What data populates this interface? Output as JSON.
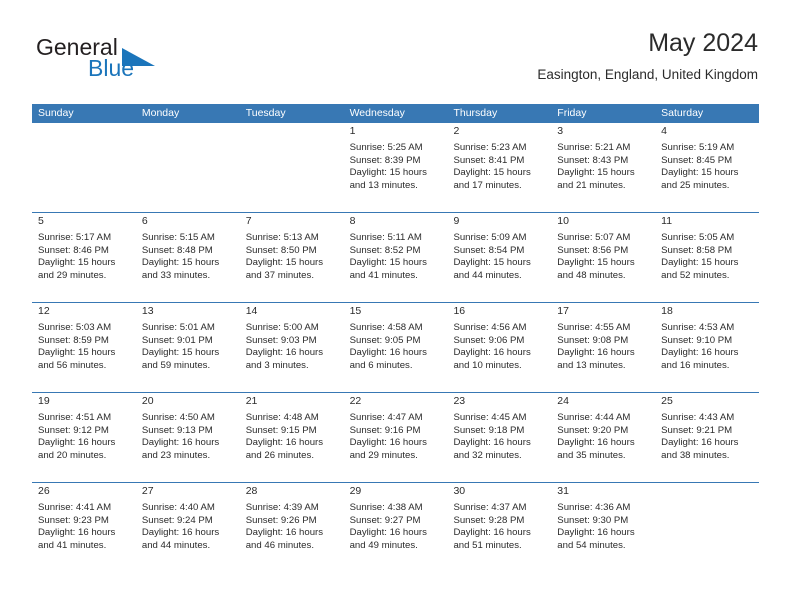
{
  "brand": {
    "name_primary": "General",
    "name_secondary": "Blue",
    "triangle_icon": "triangle-icon",
    "primary_color": "#231f20",
    "accent_color": "#1b75bb"
  },
  "header": {
    "title": "May 2024",
    "subtitle": "Easington, England, United Kingdom"
  },
  "theme": {
    "header_blue": "#3878b4",
    "daynum_band": "#f0f0f0",
    "text": "#2b2b2b",
    "page_background": "#ffffff"
  },
  "calendar": {
    "weekdays": [
      "Sunday",
      "Monday",
      "Tuesday",
      "Wednesday",
      "Thursday",
      "Friday",
      "Saturday"
    ],
    "weeks": [
      [
        {
          "day": "",
          "lines": []
        },
        {
          "day": "",
          "lines": []
        },
        {
          "day": "",
          "lines": []
        },
        {
          "day": "1",
          "lines": [
            "Sunrise: 5:25 AM",
            "Sunset: 8:39 PM",
            "Daylight: 15 hours",
            "and 13 minutes."
          ]
        },
        {
          "day": "2",
          "lines": [
            "Sunrise: 5:23 AM",
            "Sunset: 8:41 PM",
            "Daylight: 15 hours",
            "and 17 minutes."
          ]
        },
        {
          "day": "3",
          "lines": [
            "Sunrise: 5:21 AM",
            "Sunset: 8:43 PM",
            "Daylight: 15 hours",
            "and 21 minutes."
          ]
        },
        {
          "day": "4",
          "lines": [
            "Sunrise: 5:19 AM",
            "Sunset: 8:45 PM",
            "Daylight: 15 hours",
            "and 25 minutes."
          ]
        }
      ],
      [
        {
          "day": "5",
          "lines": [
            "Sunrise: 5:17 AM",
            "Sunset: 8:46 PM",
            "Daylight: 15 hours",
            "and 29 minutes."
          ]
        },
        {
          "day": "6",
          "lines": [
            "Sunrise: 5:15 AM",
            "Sunset: 8:48 PM",
            "Daylight: 15 hours",
            "and 33 minutes."
          ]
        },
        {
          "day": "7",
          "lines": [
            "Sunrise: 5:13 AM",
            "Sunset: 8:50 PM",
            "Daylight: 15 hours",
            "and 37 minutes."
          ]
        },
        {
          "day": "8",
          "lines": [
            "Sunrise: 5:11 AM",
            "Sunset: 8:52 PM",
            "Daylight: 15 hours",
            "and 41 minutes."
          ]
        },
        {
          "day": "9",
          "lines": [
            "Sunrise: 5:09 AM",
            "Sunset: 8:54 PM",
            "Daylight: 15 hours",
            "and 44 minutes."
          ]
        },
        {
          "day": "10",
          "lines": [
            "Sunrise: 5:07 AM",
            "Sunset: 8:56 PM",
            "Daylight: 15 hours",
            "and 48 minutes."
          ]
        },
        {
          "day": "11",
          "lines": [
            "Sunrise: 5:05 AM",
            "Sunset: 8:58 PM",
            "Daylight: 15 hours",
            "and 52 minutes."
          ]
        }
      ],
      [
        {
          "day": "12",
          "lines": [
            "Sunrise: 5:03 AM",
            "Sunset: 8:59 PM",
            "Daylight: 15 hours",
            "and 56 minutes."
          ]
        },
        {
          "day": "13",
          "lines": [
            "Sunrise: 5:01 AM",
            "Sunset: 9:01 PM",
            "Daylight: 15 hours",
            "and 59 minutes."
          ]
        },
        {
          "day": "14",
          "lines": [
            "Sunrise: 5:00 AM",
            "Sunset: 9:03 PM",
            "Daylight: 16 hours",
            "and 3 minutes."
          ]
        },
        {
          "day": "15",
          "lines": [
            "Sunrise: 4:58 AM",
            "Sunset: 9:05 PM",
            "Daylight: 16 hours",
            "and 6 minutes."
          ]
        },
        {
          "day": "16",
          "lines": [
            "Sunrise: 4:56 AM",
            "Sunset: 9:06 PM",
            "Daylight: 16 hours",
            "and 10 minutes."
          ]
        },
        {
          "day": "17",
          "lines": [
            "Sunrise: 4:55 AM",
            "Sunset: 9:08 PM",
            "Daylight: 16 hours",
            "and 13 minutes."
          ]
        },
        {
          "day": "18",
          "lines": [
            "Sunrise: 4:53 AM",
            "Sunset: 9:10 PM",
            "Daylight: 16 hours",
            "and 16 minutes."
          ]
        }
      ],
      [
        {
          "day": "19",
          "lines": [
            "Sunrise: 4:51 AM",
            "Sunset: 9:12 PM",
            "Daylight: 16 hours",
            "and 20 minutes."
          ]
        },
        {
          "day": "20",
          "lines": [
            "Sunrise: 4:50 AM",
            "Sunset: 9:13 PM",
            "Daylight: 16 hours",
            "and 23 minutes."
          ]
        },
        {
          "day": "21",
          "lines": [
            "Sunrise: 4:48 AM",
            "Sunset: 9:15 PM",
            "Daylight: 16 hours",
            "and 26 minutes."
          ]
        },
        {
          "day": "22",
          "lines": [
            "Sunrise: 4:47 AM",
            "Sunset: 9:16 PM",
            "Daylight: 16 hours",
            "and 29 minutes."
          ]
        },
        {
          "day": "23",
          "lines": [
            "Sunrise: 4:45 AM",
            "Sunset: 9:18 PM",
            "Daylight: 16 hours",
            "and 32 minutes."
          ]
        },
        {
          "day": "24",
          "lines": [
            "Sunrise: 4:44 AM",
            "Sunset: 9:20 PM",
            "Daylight: 16 hours",
            "and 35 minutes."
          ]
        },
        {
          "day": "25",
          "lines": [
            "Sunrise: 4:43 AM",
            "Sunset: 9:21 PM",
            "Daylight: 16 hours",
            "and 38 minutes."
          ]
        }
      ],
      [
        {
          "day": "26",
          "lines": [
            "Sunrise: 4:41 AM",
            "Sunset: 9:23 PM",
            "Daylight: 16 hours",
            "and 41 minutes."
          ]
        },
        {
          "day": "27",
          "lines": [
            "Sunrise: 4:40 AM",
            "Sunset: 9:24 PM",
            "Daylight: 16 hours",
            "and 44 minutes."
          ]
        },
        {
          "day": "28",
          "lines": [
            "Sunrise: 4:39 AM",
            "Sunset: 9:26 PM",
            "Daylight: 16 hours",
            "and 46 minutes."
          ]
        },
        {
          "day": "29",
          "lines": [
            "Sunrise: 4:38 AM",
            "Sunset: 9:27 PM",
            "Daylight: 16 hours",
            "and 49 minutes."
          ]
        },
        {
          "day": "30",
          "lines": [
            "Sunrise: 4:37 AM",
            "Sunset: 9:28 PM",
            "Daylight: 16 hours",
            "and 51 minutes."
          ]
        },
        {
          "day": "31",
          "lines": [
            "Sunrise: 4:36 AM",
            "Sunset: 9:30 PM",
            "Daylight: 16 hours",
            "and 54 minutes."
          ]
        },
        {
          "day": "",
          "lines": []
        }
      ]
    ]
  }
}
